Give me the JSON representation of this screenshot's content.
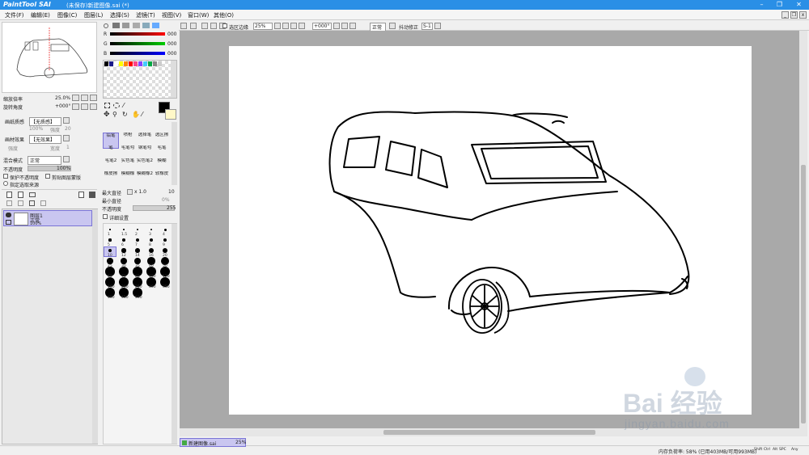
{
  "titlebar": {
    "app": "PaintTool SAI",
    "document": "(未保存)新建图像.sai (*)"
  },
  "menu": [
    "文件(F)",
    "编辑(E)",
    "图像(C)",
    "图层(L)",
    "选择(S)",
    "滤镜(T)",
    "视图(V)",
    "窗口(W)",
    "其他(O)"
  ],
  "navigator": {
    "zoom_label": "缩放倍率",
    "zoom_value": "25.0%",
    "rotate_label": "旋转角度",
    "rotate_value": "+000°"
  },
  "layer_props": {
    "paper_label": "画纸质感",
    "paper_value": "【无质感】",
    "paper_strength": "100%",
    "paper_scale": "强度",
    "paper_scale_val": "20",
    "effect_label": "画材效果",
    "effect_value": "【无效果】",
    "effect_strength_label": "强度",
    "effect_width_label": "宽度",
    "effect_width_val": "1",
    "blend_label": "混合模式",
    "blend_value": "正常",
    "opacity_label": "不透明度",
    "opacity_value": "100%",
    "protect_label": "保护不透明度",
    "clip_label": "剪贴图层蒙版",
    "source_label": "指定选取来源"
  },
  "layers": [
    {
      "name": "图层1",
      "mode": "正常",
      "opacity": "100%"
    }
  ],
  "color": {
    "r_label": "R",
    "r_value": "000",
    "g_label": "G",
    "g_value": "000",
    "b_label": "B",
    "b_value": "000"
  },
  "palette": [
    "#000000",
    "#1a1a8a",
    "#ffffff",
    "#ffff00",
    "#ff8800",
    "#ff0000",
    "#ff4488",
    "#8844ff",
    "#44ccff",
    "#00aa44",
    "#888888",
    "#cccccc"
  ],
  "tools": [
    [
      "铅笔",
      "喷枪",
      "选择笔",
      "选区擦"
    ],
    [
      "笔",
      "毛笔勾",
      "钢笔勾",
      "毛笔"
    ],
    [
      "毛笔2",
      "实色笔",
      "实色笔2",
      "模糊"
    ],
    [
      "橡皮擦",
      "模糊橡",
      "模糊橡2",
      "软橡皮"
    ]
  ],
  "brush": {
    "max_size_label": "最大直径",
    "size_mult": "x 1.0",
    "size_value": "10",
    "min_size_label": "最小直径",
    "min_size_value": "0%",
    "density_label": "不透明度",
    "density_value": "255",
    "detail_label": "详细设置"
  },
  "brush_sizes": [
    "1",
    "1.5",
    "2",
    "3",
    "4",
    "5",
    "6",
    "7",
    "8",
    "9",
    "10",
    "12",
    "14",
    "16",
    "20",
    "25",
    "30",
    "35",
    "40",
    "50",
    "60",
    "70",
    "80",
    "100",
    "120",
    "160",
    "200",
    "250",
    "300",
    "350",
    "400",
    "450",
    "500"
  ],
  "toolbar": {
    "selection_edge_label": "选区边缘",
    "zoom_value": "25%",
    "angle_value": "+000°",
    "mode_value": "正常",
    "stabilizer_label": "抖动修正",
    "stabilizer_value": "S-1"
  },
  "statusbar": {
    "doc_tab": "新建图像.sai",
    "doc_zoom": "25%",
    "memory": "内存负荷率: 58% (已用403MB/可用993MB)",
    "keys": [
      "Shift",
      "Ctrl",
      "Alt",
      "SPC",
      "Any"
    ]
  },
  "watermark": {
    "brand": "Bai 经验",
    "url": "jingyan.baidu.com"
  }
}
